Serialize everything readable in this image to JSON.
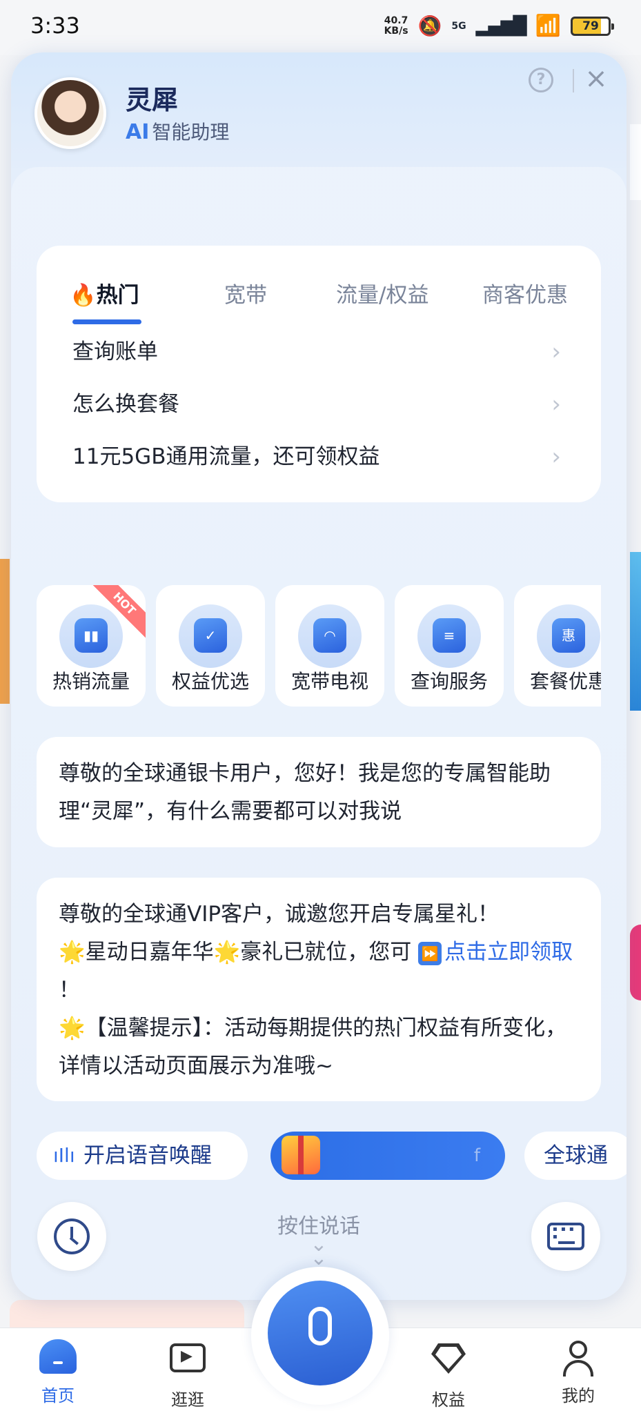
{
  "status_bar": {
    "time": "3:33",
    "speed_value": "40.7",
    "speed_unit": "KB/s",
    "network": "5G",
    "battery": "79"
  },
  "assistant": {
    "name": "灵犀",
    "subtitle_ai": "AI",
    "subtitle": "智能助理",
    "help_symbol": "?",
    "close_symbol": "×"
  },
  "faq": {
    "tabs": [
      {
        "label": "🔥热门",
        "active": true
      },
      {
        "label": "宽带",
        "active": false
      },
      {
        "label": "流量/权益",
        "active": false
      },
      {
        "label": "商客优惠",
        "active": false
      }
    ],
    "items": [
      {
        "label": "查询账单"
      },
      {
        "label": "怎么换套餐"
      },
      {
        "label": "11元5GB通用流量，还可领权益"
      }
    ],
    "chevron": "›"
  },
  "services": [
    {
      "label": "热销流量",
      "icon": "flame-chart-icon",
      "badge": "HOT"
    },
    {
      "label": "权益优选",
      "icon": "shield-check-icon"
    },
    {
      "label": "宽带电视",
      "icon": "wifi-tv-icon"
    },
    {
      "label": "查询服务",
      "icon": "document-icon"
    },
    {
      "label": "套餐优惠",
      "icon": "money-bag-icon",
      "icon_text": "惠"
    }
  ],
  "messages": {
    "greeting": "尊敬的全球通银卡用户，您好！我是您的专属智能助理“灵犀”，有什么需要都可以对我说",
    "promo_line1": "尊敬的全球通VIP客户，诚邀您开启专属星礼！",
    "promo_line2_a": "星动日嘉年华",
    "promo_line2_b": "豪礼已就位，您可",
    "promo_link": "点击立即领取",
    "promo_line2_end": "！",
    "tip_line": "【温馨提示】：活动每期提供的热门权益有所变化，详情以活动页面展示为准哦~",
    "star": "🌟",
    "ff_symbol": "⏩"
  },
  "controls": {
    "voice_wake": "开启语音唤醒",
    "promo_chip_f": "f",
    "next_chip": "全球通",
    "hold_to_talk": "按住说话",
    "hold_chevron": "⌄"
  },
  "bottom_nav": [
    {
      "label": "首页",
      "icon": "home-icon",
      "active": true
    },
    {
      "label": "逛逛",
      "icon": "video-icon",
      "active": false
    },
    {
      "label": "权益",
      "icon": "gem-icon",
      "active": false
    },
    {
      "label": "我的",
      "icon": "user-icon",
      "active": false
    }
  ],
  "colors": {
    "accent": "#2e6be6",
    "battery": "#f4c430",
    "hot": "#ff6a6a"
  }
}
